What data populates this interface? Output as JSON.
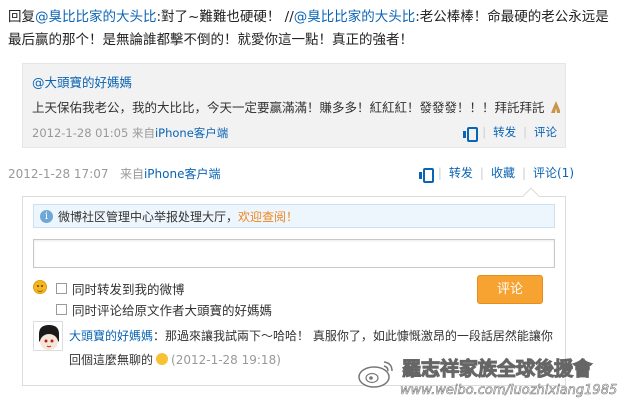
{
  "post": {
    "prefix": "回复",
    "mention1": "@臭比比家的大头比",
    "text1": ":對了~難難也硬硬！ //",
    "mention2": "@臭比比家的大头比",
    "text2": ":老公棒棒！命最硬的老公永远是最后赢的那个！是無論誰都擊不倒的！就愛你這一點！真正的強者！",
    "timestamp": "2012-1-28 17:07",
    "source_prefix": "来自",
    "source": "iPhone客户端",
    "actions": {
      "forward": "转发",
      "favorite": "收藏",
      "comment": "评论(1)"
    }
  },
  "quote": {
    "author": "@大頭寶的好媽媽",
    "text": "上天保佑我老公，我的大比比，今天一定要赢滿滿！賺多多！紅紅紅！發發發！！！拜託拜託",
    "timestamp": "2012-1-28 01:05",
    "source_prefix": "来自",
    "source": "iPhone客户端",
    "actions": {
      "forward": "转发",
      "comment": "评论"
    }
  },
  "comment_box": {
    "notice_text": "微博社区管理中心举报处理大厅，",
    "notice_link": "欢迎查阅！",
    "input_value": "",
    "option1": "同时转发到我的微博",
    "option2_prefix": "同时评论给原文作者 ",
    "option2_author": "大頭寶的好媽媽",
    "submit_label": "评论"
  },
  "reply": {
    "author": "大頭寶的好媽媽",
    "text": "：那過來讓我試兩下～哈哈！ 真服你了，如此慷慨激昂的一段話居然能讓你回個這麼無聊的",
    "timestamp": "(2012-1-28 19:18)"
  },
  "watermark": {
    "title": "羅志祥家族全球後援會",
    "url": "www.weibo.com/luozhixiang1985"
  }
}
